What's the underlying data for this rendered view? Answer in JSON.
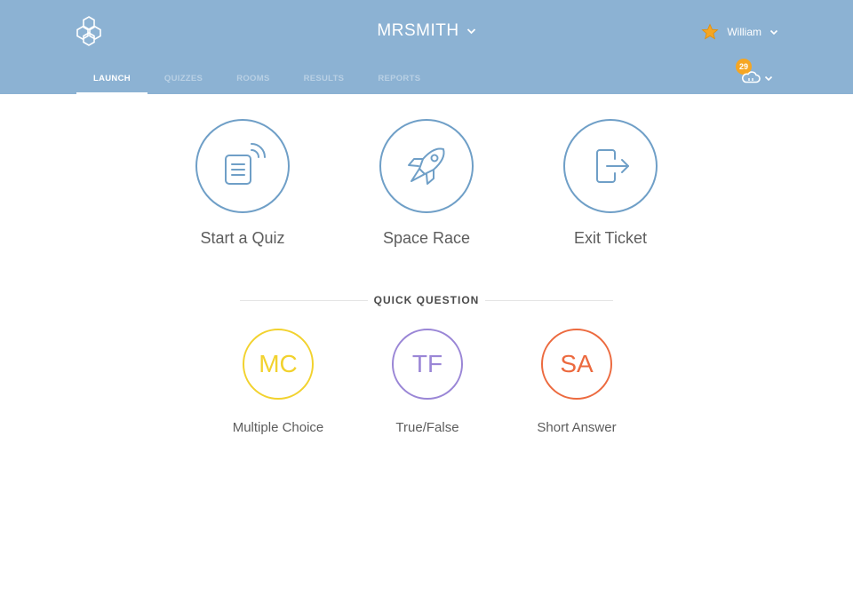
{
  "header": {
    "room_name": "MRSMITH",
    "user_name": "William",
    "notification_count": "29",
    "logo_icon": "hexagon-cluster-icon"
  },
  "tabs": [
    {
      "label": "LAUNCH",
      "active": true
    },
    {
      "label": "QUIZZES",
      "active": false
    },
    {
      "label": "ROOMS",
      "active": false
    },
    {
      "label": "RESULTS",
      "active": false
    },
    {
      "label": "REPORTS",
      "active": false
    }
  ],
  "launch": [
    {
      "label": "Start a Quiz",
      "icon": "quiz-broadcast-icon"
    },
    {
      "label": "Space Race",
      "icon": "rocket-icon"
    },
    {
      "label": "Exit Ticket",
      "icon": "exit-door-icon"
    }
  ],
  "quick_question": {
    "title": "QUICK QUESTION",
    "items": [
      {
        "abbr": "MC",
        "label": "Multiple Choice",
        "color": "#f2d22e"
      },
      {
        "abbr": "TF",
        "label": "True/False",
        "color": "#9a86d6"
      },
      {
        "abbr": "SA",
        "label": "Short Answer",
        "color": "#ec6a3f"
      }
    ]
  },
  "colors": {
    "header_bg": "#8cb2d3",
    "launch_circle": "#6f9fc7",
    "badge": "#f5a623",
    "star": "#f5a623"
  }
}
